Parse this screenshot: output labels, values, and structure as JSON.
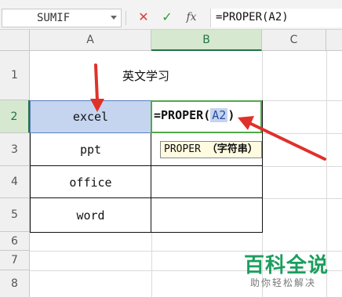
{
  "formula_bar": {
    "name_box": "SUMIF",
    "cancel_glyph": "✕",
    "enter_glyph": "✓",
    "fx_label": "fx",
    "formula": "=PROPER(A2)"
  },
  "columns": [
    {
      "label": "A"
    },
    {
      "label": "B"
    },
    {
      "label": "C"
    }
  ],
  "rows": [
    {
      "label": "1"
    },
    {
      "label": "2"
    },
    {
      "label": "3"
    },
    {
      "label": "4"
    },
    {
      "label": "5"
    },
    {
      "label": "6"
    },
    {
      "label": "7"
    },
    {
      "label": "8"
    }
  ],
  "cells": {
    "title": "英文学习",
    "a2": "excel",
    "a3": "ppt",
    "a4": "office",
    "a5": "word",
    "b2_prefix": "=PROPER(",
    "b2_ref": "A2",
    "b2_suffix": ")"
  },
  "tooltip": {
    "func": "PROPER",
    "arg": "（字符串）"
  },
  "watermark": {
    "main": "百科全说",
    "sub": "助你轻松解决"
  },
  "colors": {
    "selection_fill": "#c5d4ef",
    "active_edit_border": "#52a84a",
    "arrow": "#e0302a",
    "watermark": "#1b9e5e"
  }
}
